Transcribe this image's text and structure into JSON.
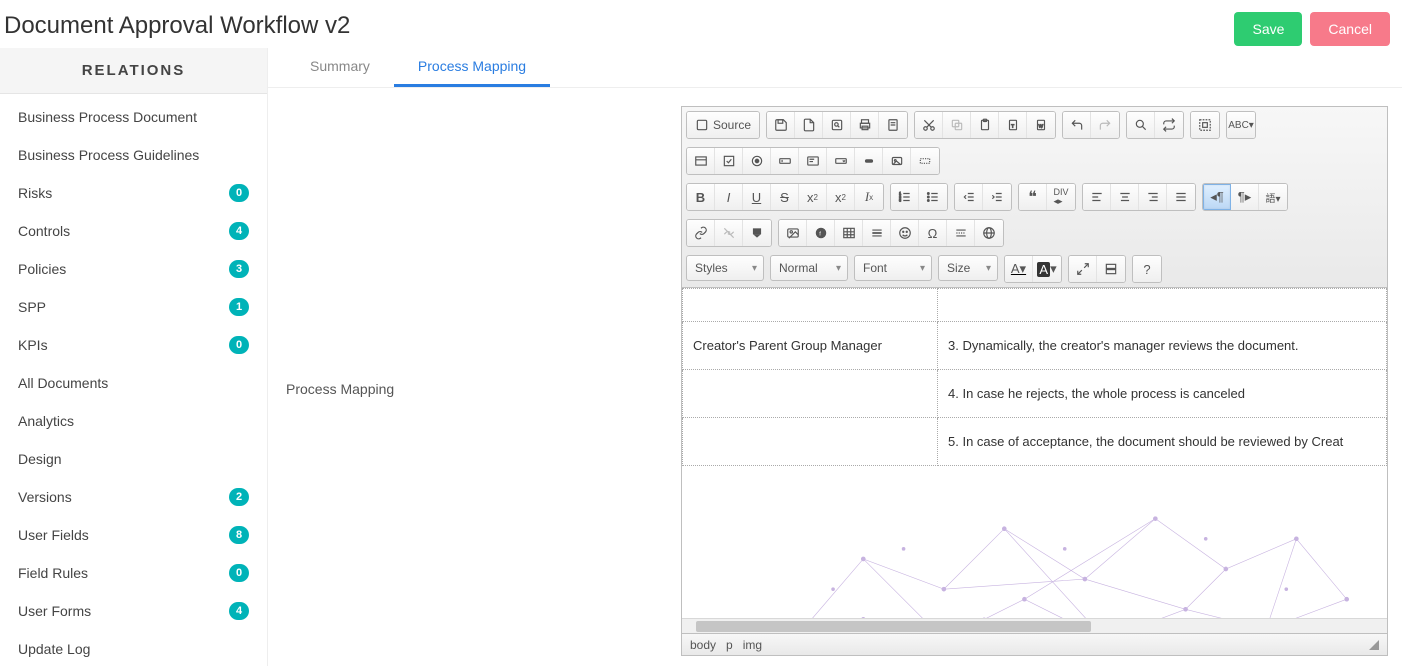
{
  "title": "Document Approval Workflow v2",
  "buttons": {
    "save": "Save",
    "cancel": "Cancel"
  },
  "sidebar": {
    "header": "RELATIONS",
    "items": [
      {
        "label": "Business Process Document",
        "badge": null
      },
      {
        "label": "Business Process Guidelines",
        "badge": null
      },
      {
        "label": "Risks",
        "badge": "0"
      },
      {
        "label": "Controls",
        "badge": "4"
      },
      {
        "label": "Policies",
        "badge": "3"
      },
      {
        "label": "SPP",
        "badge": "1"
      },
      {
        "label": "KPIs",
        "badge": "0"
      },
      {
        "label": "All Documents",
        "badge": null
      },
      {
        "label": "Analytics",
        "badge": null
      },
      {
        "label": "Design",
        "badge": null
      },
      {
        "label": "Versions",
        "badge": "2"
      },
      {
        "label": "User Fields",
        "badge": "8"
      },
      {
        "label": "Field Rules",
        "badge": "0"
      },
      {
        "label": "User Forms",
        "badge": "4"
      },
      {
        "label": "Update Log",
        "badge": null
      }
    ]
  },
  "tabs": [
    {
      "label": "Summary",
      "active": false
    },
    {
      "label": "Process Mapping",
      "active": true
    }
  ],
  "field_label": "Process Mapping",
  "editor": {
    "source_label": "Source",
    "dropdowns": {
      "styles": "Styles",
      "format": "Normal",
      "font": "Font",
      "size": "Size"
    },
    "doc_rows": [
      {
        "left": "",
        "right": ""
      },
      {
        "left": "Creator's Parent Group Manager",
        "right": "3. Dynamically, the creator's manager reviews the document."
      },
      {
        "left": "",
        "right": "4. In case he rejects, the whole process is canceled"
      },
      {
        "left": "",
        "right": "5. In case of acceptance, the document should be reviewed by Creat"
      }
    ],
    "status_path": [
      "body",
      "p",
      "img"
    ],
    "help": "?"
  }
}
